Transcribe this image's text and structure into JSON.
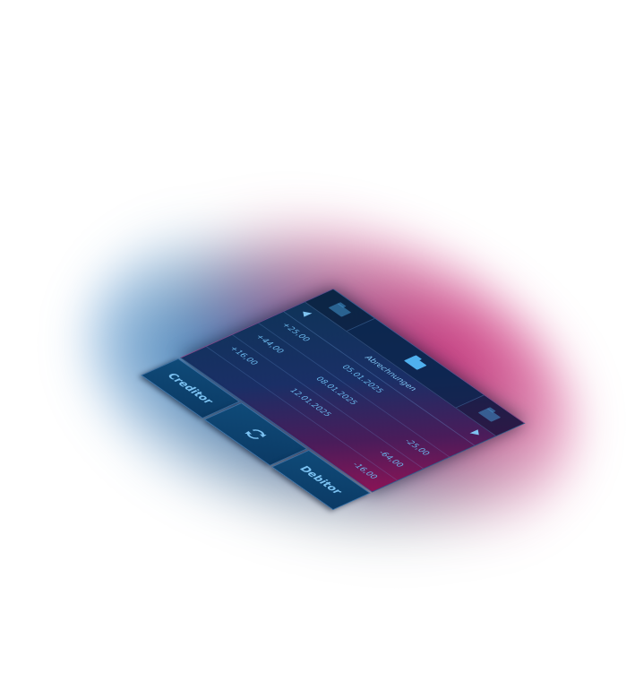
{
  "header": {
    "title": "Abrechnungen"
  },
  "transactions": [
    {
      "amount": "+25,00",
      "date": "05.01.2025",
      "value": ""
    },
    {
      "amount": "+44,00",
      "date": "08.01.2025",
      "value": "-25,00"
    },
    {
      "amount": "+16,00",
      "date": "12.01.2025",
      "value": "-64,00"
    },
    {
      "amount": "",
      "date": "",
      "value": "-16,00"
    }
  ],
  "buttons": {
    "creditor": "Creditor",
    "debitor": "Debitor"
  },
  "colors": {
    "accent": "#4fb0ee",
    "panel_blue": "#0d3457",
    "panel_magenta": "#8a1456"
  },
  "icons": {
    "left_tab": "folder-icon",
    "center_tab": "folder-icon",
    "right_tab": "folder-icon",
    "refresh": "refresh-icon",
    "prev": "arrow-left-icon",
    "next": "arrow-right-icon"
  }
}
